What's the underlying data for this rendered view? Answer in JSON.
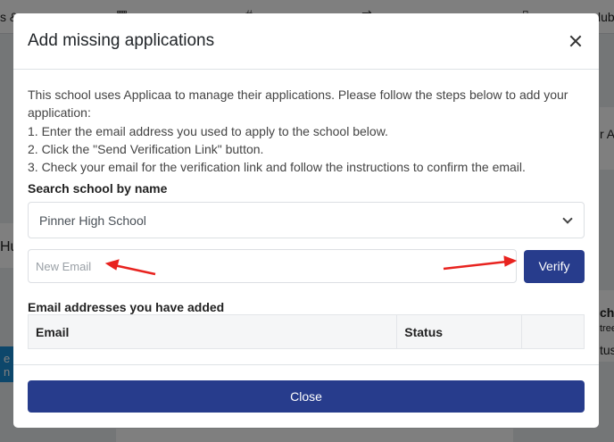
{
  "background": {
    "fragments": [
      "s &",
      "lub",
      "r Ac",
      "Hu",
      "cho",
      "tree",
      "tus",
      "e n"
    ]
  },
  "modal": {
    "title": "Add missing applications",
    "close_icon": "close-icon",
    "intro_lines": [
      "This school uses Applicaa to manage their applications. Please follow the steps below to add your application:",
      "1. Enter the email address you used to apply to the school below.",
      "2. Click the \"Send Verification Link\" button.",
      "3. Check your email for the verification link and follow the instructions to confirm the email."
    ],
    "search_label": "Search school by name",
    "school_select": {
      "selected": "Pinner High School"
    },
    "email_input": {
      "placeholder": "New Email",
      "value": ""
    },
    "verify_label": "Verify",
    "added_label": "Email addresses you have added",
    "table": {
      "columns": [
        "Email",
        "Status",
        ""
      ]
    },
    "close_label": "Close"
  },
  "annotations": {
    "arrow_color": "#e8231f"
  },
  "colors": {
    "primary": "#273c8c",
    "overlay": "rgba(0,0,0,0.5)"
  }
}
